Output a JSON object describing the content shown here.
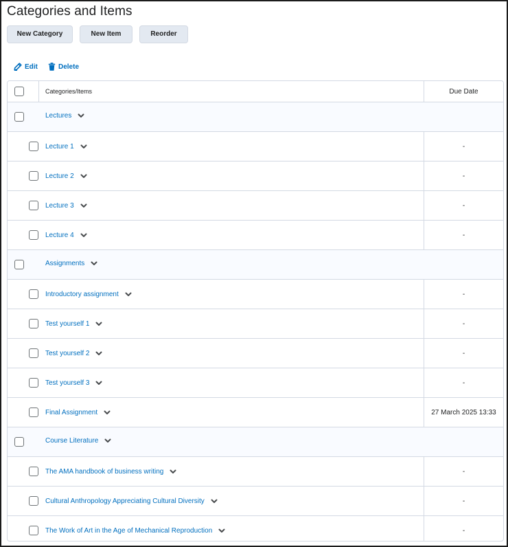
{
  "page": {
    "title": "Categories and Items"
  },
  "toolbar": {
    "new_category": "New Category",
    "new_item": "New Item",
    "reorder": "Reorder"
  },
  "actions": {
    "edit": "Edit",
    "delete": "Delete"
  },
  "table": {
    "headers": {
      "name": "Categories/Items",
      "due": "Due Date"
    },
    "rows": [
      {
        "type": "category",
        "name": "Lectures"
      },
      {
        "type": "item",
        "name": "Lecture 1",
        "due": "-"
      },
      {
        "type": "item",
        "name": "Lecture 2",
        "due": "-"
      },
      {
        "type": "item",
        "name": "Lecture 3",
        "due": "-"
      },
      {
        "type": "item",
        "name": "Lecture 4",
        "due": "-"
      },
      {
        "type": "category",
        "name": "Assignments"
      },
      {
        "type": "item",
        "name": "Introductory assignment",
        "due": "-"
      },
      {
        "type": "item",
        "name": "Test yourself 1",
        "due": "-"
      },
      {
        "type": "item",
        "name": "Test yourself 2",
        "due": "-"
      },
      {
        "type": "item",
        "name": "Test yourself 3",
        "due": "-"
      },
      {
        "type": "item",
        "name": "Final Assignment",
        "due": "27 March 2025 13:33"
      },
      {
        "type": "category",
        "name": "Course Literature"
      },
      {
        "type": "item",
        "name": "The AMA handbook of business writing",
        "due": "-"
      },
      {
        "type": "item",
        "name": "Cultural Anthropology Appreciating Cultural Diversity",
        "due": "-"
      },
      {
        "type": "item",
        "name": "The Work of Art in the Age of Mechanical Reproduction",
        "due": "-"
      }
    ]
  },
  "colors": {
    "link": "#006fbf",
    "border": "#d3d9e3",
    "button_bg": "#e3e9f1",
    "category_bg": "#f9fbff"
  }
}
